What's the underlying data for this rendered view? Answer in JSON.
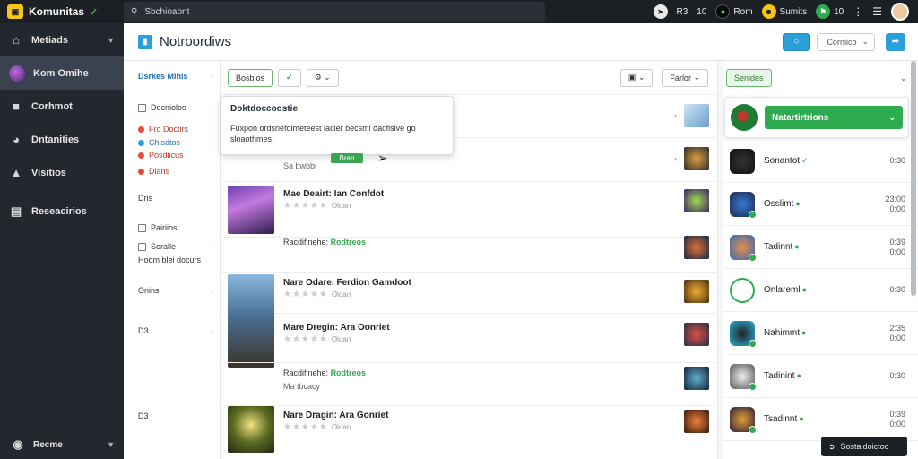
{
  "topbar": {
    "brand": "Komunitas",
    "search_placeholder": "Sbchioaont",
    "items": [
      {
        "label": "R3",
        "icon": "pin-icon"
      },
      {
        "label": "10",
        "icon": "gear-icon"
      },
      {
        "label": "Rom",
        "icon": "controller-icon"
      },
      {
        "label": "Sumits",
        "icon": "user-icon"
      },
      {
        "label": "10",
        "icon": "flag-icon"
      }
    ]
  },
  "sidebar": {
    "items": [
      {
        "label": "Metiads",
        "icon": "home-icon",
        "active": false
      },
      {
        "label": "Kom Omihe",
        "icon": "avatar",
        "active": true
      },
      {
        "label": "Corhmot",
        "icon": "chat-icon",
        "active": false
      },
      {
        "label": "Dntanities",
        "icon": "globe-icon",
        "active": false
      },
      {
        "label": "Visitios",
        "icon": "chart-icon",
        "active": false
      },
      {
        "label": "Reseacirios",
        "icon": "list-icon",
        "active": false
      }
    ],
    "footer": "Recme"
  },
  "header": {
    "title": "Notroordiws",
    "select_label": "Corniico"
  },
  "filters": {
    "heading": "Dsrkes Mihis",
    "group1": "Docniolos",
    "group1_items": [
      {
        "label": "Fro Doctirs",
        "color": "#e74c3c"
      },
      {
        "label": "Chlsdtos",
        "color": "#29a0d8"
      },
      {
        "label": "Posdiicus",
        "color": "#e74c3c"
      },
      {
        "label": "Dlans",
        "color": "#e74c3c"
      }
    ],
    "label_dris": "Dris",
    "item_pains": "Pairiios",
    "item_soralte": "Soralle",
    "item_hoom": "Hoom blei docurs",
    "label_onins": "Onins",
    "label_d3": "D3",
    "label_d3b": "D3"
  },
  "toolbar": {
    "sort_label": "Bosbios",
    "check_label": "✓",
    "filter_label": "Farlor"
  },
  "popover": {
    "title": "Doktdoccoostie",
    "body": "Fuxpon ordsnefoimeteest lacier becsml oacfisive go sloaothmes."
  },
  "rows": [
    {
      "title": "",
      "sub": "",
      "stars": "",
      "green": "",
      "green_label": ""
    },
    {
      "title": "",
      "sub": "Sa bwbbi",
      "green_chip": "Bran",
      "stars": "",
      "green": "",
      "green_label": ""
    },
    {
      "title": "Mae Deairt: Ian Confdot",
      "stars": "★★★★★",
      "stars_label": "Oldan"
    },
    {
      "green_prefix": "Racdifinehe:",
      "green_label": "Rodtreos",
      "stars": ""
    },
    {
      "title": "Nare Odare. Ferdion Gamdoot",
      "stars": "★★★★★",
      "stars_label": "Oldan"
    },
    {
      "title": "Mare Dregin: Ara Oonriet",
      "stars": "★★★★★",
      "stars_label": "Oldan"
    },
    {
      "green_prefix": "Racdifinehe:",
      "green_label": "Rodtreos",
      "sub": "Ma tbcacy"
    },
    {
      "title": "Nare Dragin: Ara Gonriet",
      "stars": "★★★★★",
      "stars_label": "Oldan"
    }
  ],
  "rightpanel": {
    "tag": "Senides",
    "notification_button": "Natartirtrions",
    "users": [
      {
        "name": "Sonantot",
        "status": "✓",
        "time1": "0:30",
        "time2": ""
      },
      {
        "name": "Osslimt",
        "status": "●",
        "time1": "23:00",
        "time2": "0:00"
      },
      {
        "name": "Tadinnt",
        "status": "●",
        "time1": "0:39",
        "time2": "0:00"
      },
      {
        "name": "Onlareml",
        "status": "●",
        "time1": "0:30",
        "time2": ""
      },
      {
        "name": "Nahimmt",
        "status": "●",
        "time1": "2:35",
        "time2": "0:00"
      },
      {
        "name": "Tadinint",
        "status": "●",
        "time1": "0:30",
        "time2": ""
      },
      {
        "name": "Tsadinnt",
        "status": "●",
        "time1": "0:39",
        "time2": "0:00"
      }
    ]
  },
  "toast": {
    "label": "Sostaidoictoc"
  }
}
